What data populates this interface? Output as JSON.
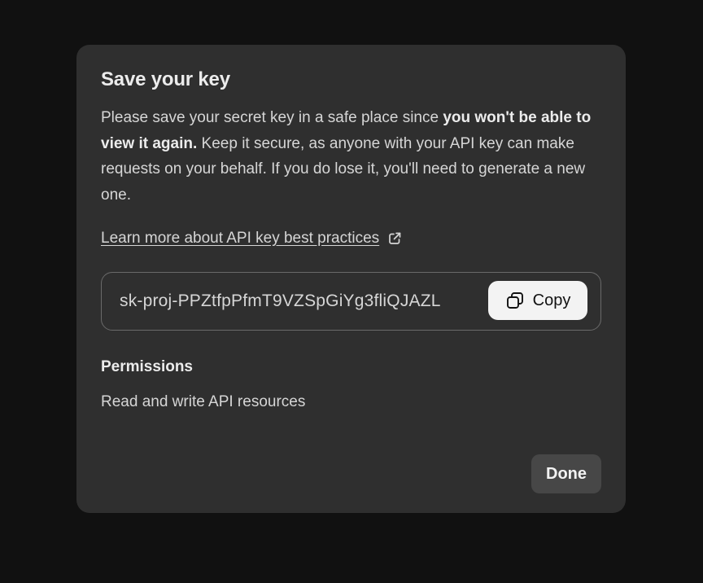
{
  "modal": {
    "title": "Save your key",
    "description": {
      "part1": "Please save your secret key in a safe place since ",
      "bold": "you won't be able to view it again.",
      "part2": " Keep it secure, as anyone with your API key can make requests on your behalf. If you do lose it, you'll need to generate a new one."
    },
    "learn_more_link": "Learn more about API key best practices",
    "learn_more_icon": "external-link-icon",
    "key_value": "sk-proj-PPZtfpPfmT9VZSpGiYg3fliQJAZL",
    "copy_button": {
      "label": "Copy",
      "icon": "copy-icon"
    },
    "permissions": {
      "heading": "Permissions",
      "value": "Read and write API resources"
    },
    "done_button": "Done"
  },
  "colors": {
    "backdrop": "#111111",
    "modal_bg": "#2f2f2f",
    "text_primary": "#ececec",
    "text_secondary": "#d6d6d6",
    "copy_button_bg": "#f3f3f3",
    "done_button_bg": "#474747"
  }
}
